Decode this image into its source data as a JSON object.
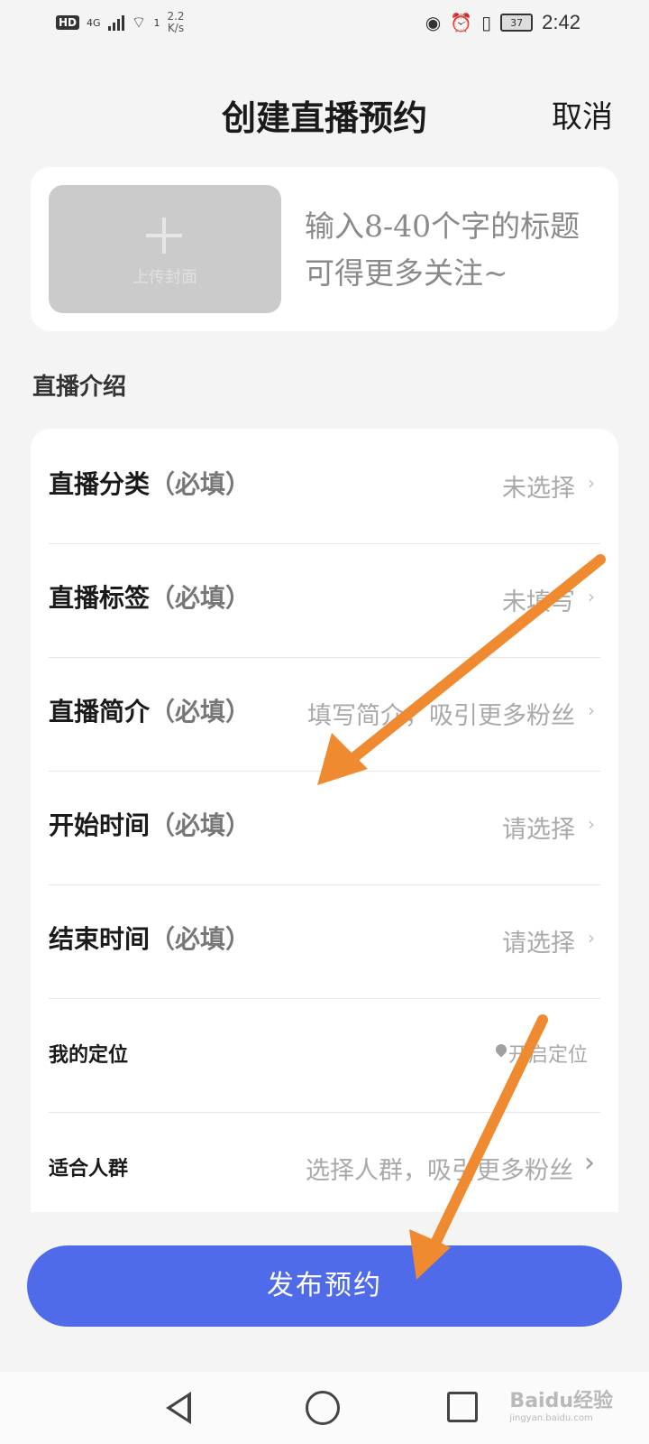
{
  "status_bar": {
    "hd": "HD",
    "network": "4G",
    "wifi_badge": "1",
    "speed_value": "2.2",
    "speed_unit": "K/s",
    "battery": "37",
    "time": "2:42"
  },
  "header": {
    "title": "创建直播预约",
    "cancel_label": "取消"
  },
  "cover": {
    "upload_label": "上传封面",
    "title_placeholder": "输入8-40个字的标题可得更多关注~"
  },
  "section_label": "直播介绍",
  "form_rows": [
    {
      "label": "直播分类",
      "required": "（必填）",
      "value": "未选择"
    },
    {
      "label": "直播标签",
      "required": "（必填）",
      "value": "未填写"
    },
    {
      "label": "直播简介",
      "required": "（必填）",
      "value": "填写简介，吸引更多粉丝"
    },
    {
      "label": "开始时间",
      "required": "（必填）",
      "value": "请选择"
    },
    {
      "label": "结束时间",
      "required": "（必填）",
      "value": "请选择"
    },
    {
      "label": "我的定位",
      "required": "",
      "value": "开启定位"
    },
    {
      "label": "适合人群",
      "required": "",
      "value": "选择人群，吸引更多粉丝"
    }
  ],
  "publish_button": "发布预约",
  "watermark": {
    "brand": "Baidu经验",
    "url": "jingyan.baidu.com"
  },
  "colors": {
    "accent": "#4f6bea",
    "annotation_arrow": "#f08a30"
  }
}
